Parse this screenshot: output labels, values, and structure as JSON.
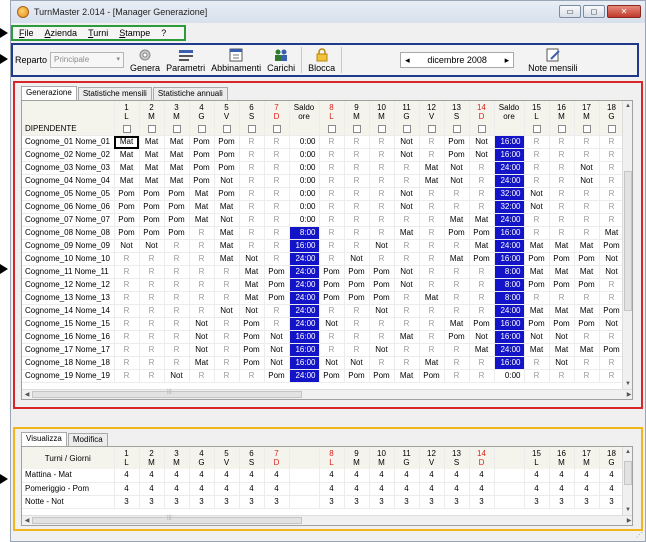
{
  "window": {
    "title": "TurnMaster 2.014 - [Manager Generazione]",
    "buttons": {
      "minimize": "▭",
      "maximize": "◻",
      "close": "✕"
    }
  },
  "menu": [
    {
      "label": "File",
      "key": "F"
    },
    {
      "label": "Azienda",
      "key": "A"
    },
    {
      "label": "Turni",
      "key": "T"
    },
    {
      "label": "Stampe",
      "key": "S"
    },
    {
      "label": "?",
      "key": ""
    }
  ],
  "toolbar": {
    "reparto_label": "Reparto",
    "reparto_value": "Principale",
    "genera": "Genera",
    "parametri": "Parametri",
    "abbinamenti": "Abbinamenti",
    "carichi": "Carichi",
    "blocca": "Blocca",
    "month": "dicembre 2008",
    "prev": "◂",
    "next": "▸",
    "note": "Note mensili"
  },
  "main_tabs": [
    "Generazione",
    "Statistiche mensili",
    "Statistiche annuali"
  ],
  "grid": {
    "dep_header": "DIPENDENTE",
    "saldo_label": [
      "Saldo",
      "ore"
    ],
    "columns": [
      {
        "n": "1",
        "d": "L",
        "red": false
      },
      {
        "n": "2",
        "d": "M",
        "red": false
      },
      {
        "n": "3",
        "d": "M",
        "red": false
      },
      {
        "n": "4",
        "d": "G",
        "red": false
      },
      {
        "n": "5",
        "d": "V",
        "red": false
      },
      {
        "n": "6",
        "d": "S",
        "red": false
      },
      {
        "n": "7",
        "d": "D",
        "red": true
      },
      {
        "saldo": true
      },
      {
        "n": "8",
        "d": "L",
        "red": true
      },
      {
        "n": "9",
        "d": "M",
        "red": false
      },
      {
        "n": "10",
        "d": "M",
        "red": false
      },
      {
        "n": "11",
        "d": "G",
        "red": false
      },
      {
        "n": "12",
        "d": "V",
        "red": false
      },
      {
        "n": "13",
        "d": "S",
        "red": false
      },
      {
        "n": "14",
        "d": "D",
        "red": true
      },
      {
        "saldo": true
      },
      {
        "n": "15",
        "d": "L",
        "red": false
      },
      {
        "n": "16",
        "d": "M",
        "red": false
      },
      {
        "n": "17",
        "d": "M",
        "red": false
      },
      {
        "n": "18",
        "d": "G",
        "red": false
      }
    ],
    "rows": [
      {
        "name": "Cognome_01 Nome_01",
        "w1": [
          "Mat",
          "Mat",
          "Mat",
          "Pom",
          "Pom",
          "R",
          "R"
        ],
        "s1": "0:00",
        "w2": [
          "R",
          "R",
          "R",
          "Not",
          "R",
          "Pom",
          "Not"
        ],
        "s2": "16:00",
        "w3": [
          "R",
          "R",
          "R",
          "R"
        ]
      },
      {
        "name": "Cognome_02 Nome_02",
        "w1": [
          "Mat",
          "Mat",
          "Mat",
          "Pom",
          "Pom",
          "R",
          "R"
        ],
        "s1": "0:00",
        "w2": [
          "R",
          "R",
          "R",
          "Not",
          "R",
          "Pom",
          "Not"
        ],
        "s2": "16:00",
        "w3": [
          "R",
          "R",
          "R",
          "R"
        ]
      },
      {
        "name": "Cognome_03 Nome_03",
        "w1": [
          "Mat",
          "Mat",
          "Mat",
          "Pom",
          "Pom",
          "R",
          "R"
        ],
        "s1": "0:00",
        "w2": [
          "R",
          "R",
          "R",
          "R",
          "Mat",
          "Not",
          "R"
        ],
        "s2": "24:00",
        "w3": [
          "R",
          "R",
          "Not",
          "R"
        ]
      },
      {
        "name": "Cognome_04 Nome_04",
        "w1": [
          "Mat",
          "Mat",
          "Mat",
          "Pom",
          "Not",
          "R",
          "R"
        ],
        "s1": "0:00",
        "w2": [
          "R",
          "R",
          "R",
          "R",
          "Mat",
          "Not",
          "R"
        ],
        "s2": "24:00",
        "w3": [
          "R",
          "R",
          "Not",
          "R"
        ]
      },
      {
        "name": "Cognome_05 Nome_05",
        "w1": [
          "Pom",
          "Pom",
          "Pom",
          "Mat",
          "Pom",
          "R",
          "R"
        ],
        "s1": "0:00",
        "w2": [
          "R",
          "R",
          "R",
          "Not",
          "R",
          "R",
          "R"
        ],
        "s2": "32:00",
        "w3": [
          "Not",
          "R",
          "R",
          "R"
        ]
      },
      {
        "name": "Cognome_06 Nome_06",
        "w1": [
          "Pom",
          "Pom",
          "Pom",
          "Mat",
          "Mat",
          "R",
          "R"
        ],
        "s1": "0:00",
        "w2": [
          "R",
          "R",
          "R",
          "Not",
          "R",
          "R",
          "R"
        ],
        "s2": "32:00",
        "w3": [
          "Not",
          "R",
          "R",
          "R"
        ]
      },
      {
        "name": "Cognome_07 Nome_07",
        "w1": [
          "Pom",
          "Pom",
          "Pom",
          "Mat",
          "Not",
          "R",
          "R"
        ],
        "s1": "0:00",
        "w2": [
          "R",
          "R",
          "R",
          "R",
          "R",
          "Mat",
          "Mat"
        ],
        "s2": "24:00",
        "w3": [
          "R",
          "R",
          "R",
          "R"
        ]
      },
      {
        "name": "Cognome_08 Nome_08",
        "w1": [
          "Pom",
          "Pom",
          "Pom",
          "R",
          "Mat",
          "R",
          "R"
        ],
        "s1": "8:00",
        "w2": [
          "R",
          "R",
          "R",
          "Mat",
          "R",
          "Pom",
          "Pom"
        ],
        "s2": "16:00",
        "w3": [
          "R",
          "R",
          "R",
          "Mat"
        ]
      },
      {
        "name": "Cognome_09 Nome_09",
        "w1": [
          "Not",
          "Not",
          "R",
          "R",
          "Mat",
          "R",
          "R"
        ],
        "s1": "16:00",
        "w2": [
          "R",
          "R",
          "Not",
          "R",
          "R",
          "R",
          "Mat"
        ],
        "s2": "24:00",
        "w3": [
          "Mat",
          "Mat",
          "Mat",
          "Pom"
        ]
      },
      {
        "name": "Cognome_10 Nome_10",
        "w1": [
          "R",
          "R",
          "R",
          "R",
          "Mat",
          "Not",
          "R"
        ],
        "s1": "24:00",
        "w2": [
          "R",
          "Not",
          "R",
          "R",
          "R",
          "Mat",
          "Pom"
        ],
        "s2": "16:00",
        "w3": [
          "Pom",
          "Pom",
          "Pom",
          "Not"
        ]
      },
      {
        "name": "Cognome_11 Nome_11",
        "w1": [
          "R",
          "R",
          "R",
          "R",
          "R",
          "Mat",
          "Pom"
        ],
        "s1": "24:00",
        "w2": [
          "Pom",
          "Pom",
          "Pom",
          "Not",
          "R",
          "R",
          "R"
        ],
        "s2": "8:00",
        "w3": [
          "Mat",
          "Mat",
          "Mat",
          "Not"
        ]
      },
      {
        "name": "Cognome_12 Nome_12",
        "w1": [
          "R",
          "R",
          "R",
          "R",
          "R",
          "Mat",
          "Pom"
        ],
        "s1": "24:00",
        "w2": [
          "Pom",
          "Pom",
          "Pom",
          "Not",
          "R",
          "R",
          "R"
        ],
        "s2": "8:00",
        "w3": [
          "Pom",
          "Pom",
          "Pom",
          "R"
        ]
      },
      {
        "name": "Cognome_13 Nome_13",
        "w1": [
          "R",
          "R",
          "R",
          "R",
          "R",
          "Mat",
          "Pom"
        ],
        "s1": "24:00",
        "w2": [
          "Pom",
          "Pom",
          "Pom",
          "R",
          "Mat",
          "R",
          "R"
        ],
        "s2": "8:00",
        "w3": [
          "R",
          "R",
          "R",
          "R"
        ]
      },
      {
        "name": "Cognome_14 Nome_14",
        "w1": [
          "R",
          "R",
          "R",
          "R",
          "Not",
          "Not",
          "R"
        ],
        "s1": "24:00",
        "w2": [
          "R",
          "R",
          "Not",
          "R",
          "R",
          "R",
          "R"
        ],
        "s2": "24:00",
        "w3": [
          "Mat",
          "Mat",
          "Mat",
          "Pom"
        ]
      },
      {
        "name": "Cognome_15 Nome_15",
        "w1": [
          "R",
          "R",
          "R",
          "Not",
          "R",
          "Pom",
          "R"
        ],
        "s1": "24:00",
        "w2": [
          "Not",
          "R",
          "R",
          "R",
          "R",
          "Mat",
          "Pom"
        ],
        "s2": "16:00",
        "w3": [
          "Pom",
          "Pom",
          "Pom",
          "Not"
        ]
      },
      {
        "name": "Cognome_16 Nome_16",
        "w1": [
          "R",
          "R",
          "R",
          "Not",
          "R",
          "Pom",
          "Not"
        ],
        "s1": "16:00",
        "w2": [
          "R",
          "R",
          "R",
          "Mat",
          "R",
          "Pom",
          "Not"
        ],
        "s2": "16:00",
        "w3": [
          "Not",
          "Not",
          "R",
          "R"
        ]
      },
      {
        "name": "Cognome_17 Nome_17",
        "w1": [
          "R",
          "R",
          "R",
          "Not",
          "R",
          "Pom",
          "Not"
        ],
        "s1": "16:00",
        "w2": [
          "R",
          "R",
          "Not",
          "R",
          "R",
          "R",
          "Mat"
        ],
        "s2": "24:00",
        "w3": [
          "Mat",
          "Mat",
          "Mat",
          "Pom"
        ]
      },
      {
        "name": "Cognome_18 Nome_18",
        "w1": [
          "R",
          "R",
          "R",
          "Mat",
          "R",
          "Pom",
          "Not"
        ],
        "s1": "16:00",
        "w2": [
          "Not",
          "Not",
          "R",
          "R",
          "Mat",
          "R",
          "R"
        ],
        "s2": "16:00",
        "w3": [
          "R",
          "Not",
          "R",
          "R"
        ]
      },
      {
        "name": "Cognome_19 Nome_19",
        "w1": [
          "R",
          "R",
          "Not",
          "R",
          "R",
          "R",
          "Pom"
        ],
        "s1": "24:00",
        "w2": [
          "Pom",
          "Pom",
          "Pom",
          "Mat",
          "Pom",
          "R",
          "R"
        ],
        "s2": "0:00",
        "w3": [
          "R",
          "R",
          "R",
          "R"
        ]
      }
    ]
  },
  "bottom_tabs": [
    "Visualizza",
    "Modifica"
  ],
  "bottom_grid": {
    "header": "Turni / Giorni",
    "rows": [
      {
        "name": "Mattina - Mat",
        "values": [
          "4",
          "4",
          "4",
          "4",
          "4",
          "4",
          "4",
          "4",
          "4",
          "4",
          "4",
          "4",
          "4",
          "4",
          "4",
          "4",
          "4",
          "4"
        ]
      },
      {
        "name": "Pomeriggio - Pom",
        "values": [
          "4",
          "4",
          "4",
          "4",
          "4",
          "4",
          "4",
          "4",
          "4",
          "4",
          "4",
          "4",
          "4",
          "4",
          "4",
          "4",
          "4",
          "4"
        ]
      },
      {
        "name": "Notte - Not",
        "values": [
          "3",
          "3",
          "3",
          "3",
          "3",
          "3",
          "3",
          "3",
          "3",
          "3",
          "3",
          "3",
          "3",
          "3",
          "3",
          "3",
          "3",
          "3"
        ]
      }
    ]
  },
  "colors": {
    "green_frame": "#2e9b3a",
    "blue_frame": "#1f3a8a",
    "red_frame": "#d8262b",
    "yellow_frame": "#f2b51c",
    "saldo_highlight": "#1313c8",
    "weekend_red": "#d22222"
  },
  "icons": {
    "app": "turnmaster-app-icon",
    "genera": "gear-icon",
    "parametri": "parameters-icon",
    "abbinamenti": "calendar-pairing-icon",
    "carichi": "people-icon",
    "blocca": "lock-icon",
    "note": "note-pencil-icon"
  }
}
